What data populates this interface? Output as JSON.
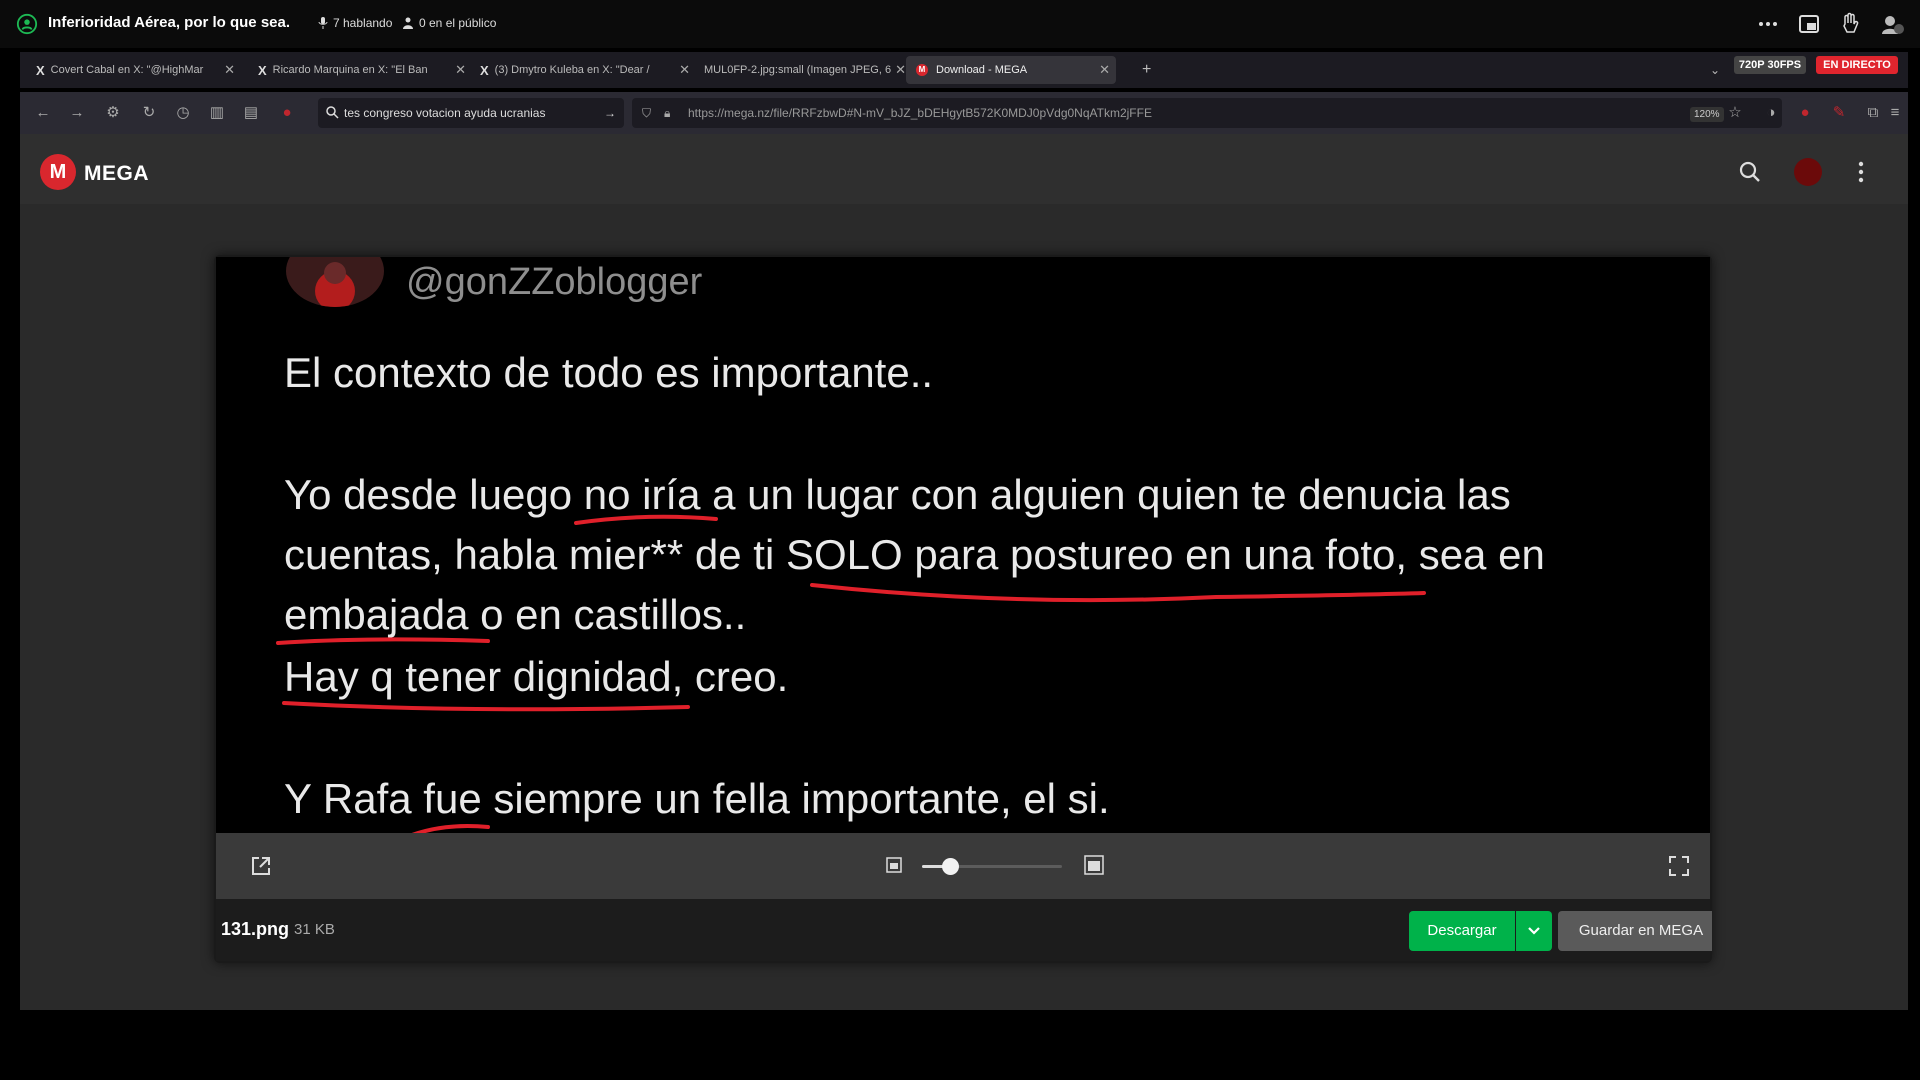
{
  "space": {
    "title": "Inferioridad Aérea, por lo que sea.",
    "speakers": "7 hablando",
    "listeners": "0 en el público",
    "badge_quality": "720P 30FPS",
    "badge_live": "EN DIRECTO"
  },
  "browser": {
    "tabs": [
      {
        "label": "Covert Cabal en X: \"@HighMar"
      },
      {
        "label": "Ricardo Marquina en X: \"El Ban"
      },
      {
        "label": "(3) Dmytro Kuleba en X: \"Dear /"
      },
      {
        "label": "MUL0FP-2.jpg:small (Imagen JPEG, 6"
      },
      {
        "label": "Download - MEGA"
      }
    ],
    "search_text": "tes congreso votacion ayuda ucranias",
    "url": "https://mega.nz/file/RRFzbwD#N-mV_bJZ_bDEHgytB572K0MDJ0pVdg0NqATkm2jFFE",
    "zoom": "120%"
  },
  "mega": {
    "logo_text": "MEGA",
    "logo_letter": "M"
  },
  "preview": {
    "handle": "@gonZZoblogger",
    "lines": [
      "El contexto de todo es importante..",
      "Yo desde luego no iría a un lugar con alguien quien te denucia las",
      "cuentas, habla mier** de ti SOLO para postureo en una foto, sea en",
      "embajada o en castillos..",
      "Hay q tener dignidad, creo.",
      "Y Rafa fue siempre un fella importante, el si."
    ],
    "underline_color": "#e0202a"
  },
  "file": {
    "name": "131.png",
    "size": "31 KB",
    "zoom_fraction": 0.2
  },
  "buttons": {
    "download": "Descargar",
    "save": "Guardar en MEGA"
  },
  "colors": {
    "mega_red": "#d9272e",
    "download_green": "#00b24a",
    "live_red": "#e0252e"
  }
}
